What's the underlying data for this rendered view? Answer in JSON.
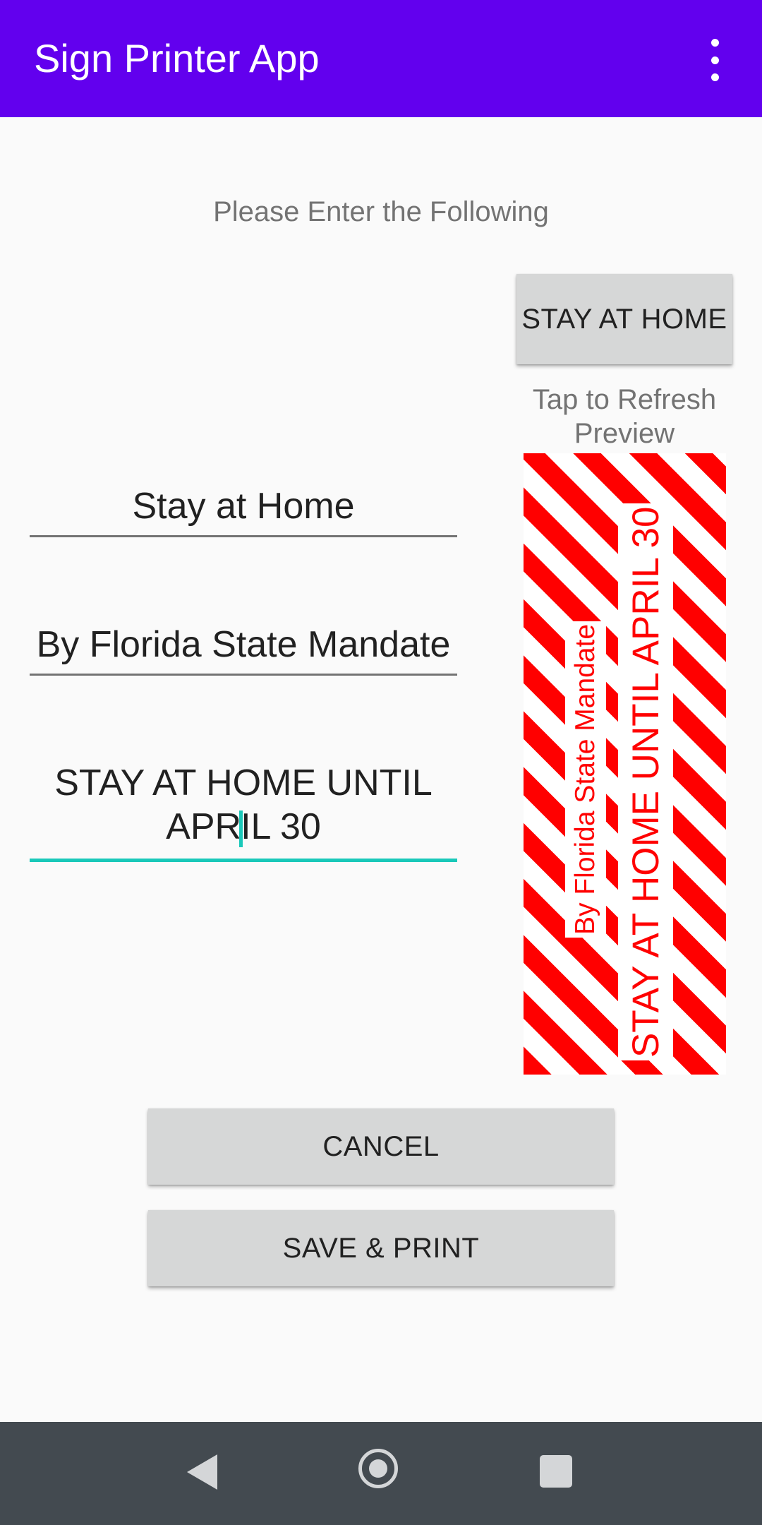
{
  "app_bar": {
    "title": "Sign Printer App",
    "overflow_icon": "more-vert-icon",
    "background_color": "#6200ee"
  },
  "form": {
    "instruction": "Please Enter the Following",
    "title_field": {
      "value": "Stay at Home"
    },
    "subtitle_field": {
      "value": "By Florida State Mandate"
    },
    "message_field": {
      "value_line1": "STAY AT HOME UNTIL",
      "value_line2_before_cursor": "APR",
      "value_line2_after_cursor": "IL 30",
      "focused": true,
      "accent_color": "#19c8b9"
    }
  },
  "preview": {
    "button_label": "STAY AT HOME",
    "refresh_hint": "Tap to Refresh Preview",
    "sign_main_text": "STAY AT HOME UNTIL APRIL 30",
    "sign_sub_text": "By Florida State Mandate",
    "stripe_colors": [
      "#ff0000",
      "#ffffff"
    ]
  },
  "actions": {
    "cancel_label": "CANCEL",
    "save_print_label": "SAVE & PRINT"
  },
  "nav_bar": {
    "back_icon": "back-triangle-icon",
    "home_icon": "home-circle-icon",
    "recents_icon": "recents-square-icon"
  }
}
